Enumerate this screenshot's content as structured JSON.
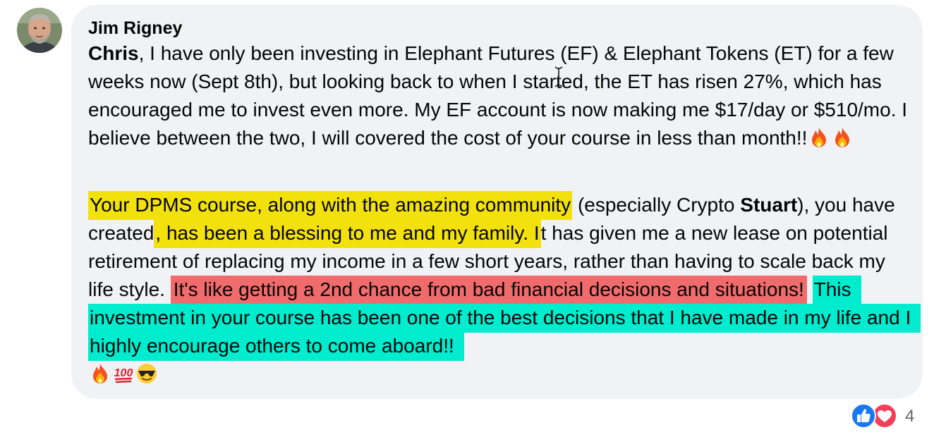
{
  "comment": {
    "author": "Jim Rigney",
    "paragraph1": {
      "mention": "Chris",
      "text": ", I have only been investing in Elephant Futures (EF) & Elephant Tokens (ET) for a few weeks now (Sept 8th), but looking back to when I started, the ET has risen 27%, which has encouraged me to invest even more. My EF account is now making me $17/day or $510/mo. I believe between the two, I will covered the cost of your course in less than month!!",
      "emojis": [
        "fire-emoji",
        "fire-emoji"
      ]
    },
    "paragraph2": {
      "highlight_yellow_1": "Your DPMS course, along with the amazing community",
      "text_a": " (especially Crypto ",
      "mention": "Stuart",
      "text_b": "), you have created",
      "highlight_yellow_2": ", has been a blessing to me and my family. I",
      "text_c": "t has given me a new lease on potential retirement of replacing my income in a few short years, rather than having to scale back my life style. ",
      "highlight_red": "It's like getting a 2nd chance from bad financial decisions and situations!",
      "text_d": " ",
      "highlight_cyan": "This investment in your course has been one of the best decisions that I have made in my life and I highly encourage others to come aboard!!",
      "emojis": [
        "fire-emoji",
        "hundred-points-emoji",
        "sunglasses-emoji"
      ]
    }
  },
  "reactions": {
    "types": [
      "like-icon",
      "love-icon"
    ],
    "count": "4"
  },
  "colors": {
    "bubble": "#f0f2f5",
    "highlight_yellow": "#f2e10c",
    "highlight_red": "#f06c6c",
    "highlight_cyan": "#00ecce",
    "like_blue": "#1877f2",
    "love_red": "#f33e58",
    "meta_gray": "#65676b"
  }
}
